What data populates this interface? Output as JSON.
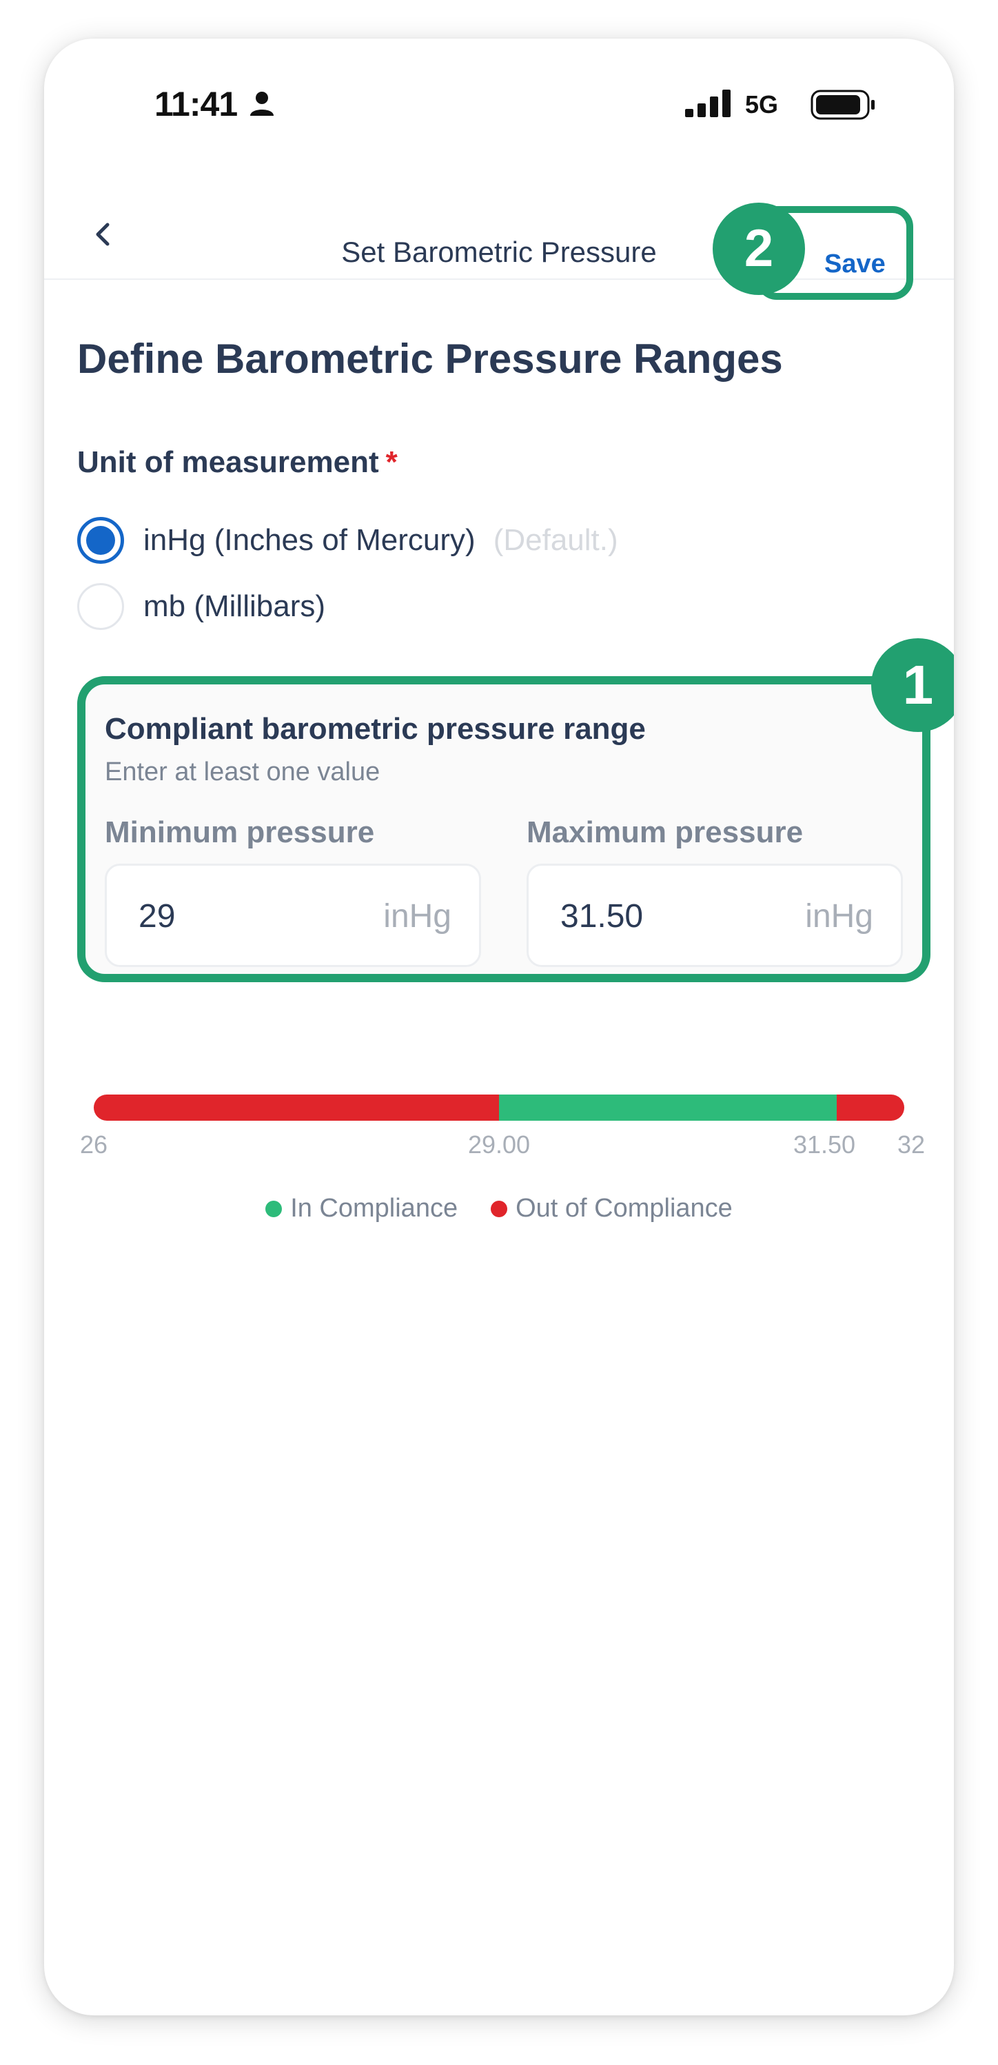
{
  "status_bar": {
    "time": "11:41",
    "network": "5G",
    "icons": [
      "person-icon",
      "signal-icon",
      "battery-icon"
    ]
  },
  "header": {
    "title": "Set Barometric Pressure",
    "save_label": "Save",
    "back_icon": "chevron-left-icon"
  },
  "annotations": {
    "badge_1": "1",
    "badge_2": "2"
  },
  "page": {
    "title": "Define Barometric Pressure Ranges",
    "unit_label": "Unit of measurement",
    "unit_required": "*",
    "options": [
      {
        "label": "inHg (Inches of Mercury)",
        "hint": "(Default.)",
        "selected": true
      },
      {
        "label": "mb (Millibars)",
        "hint": "",
        "selected": false
      }
    ]
  },
  "range_card": {
    "title": "Compliant barometric pressure range",
    "subtitle": "Enter at least one value",
    "min": {
      "label": "Minimum pressure",
      "value": "29",
      "unit": "inHg"
    },
    "max": {
      "label": "Maximum pressure",
      "value": "31.50",
      "unit": "inHg"
    }
  },
  "compliance_bar": {
    "scale_min": 26,
    "scale_max": 32,
    "compliant_from": 29.0,
    "compliant_to": 31.5,
    "ticks": [
      "26",
      "29.00",
      "31.50",
      "32"
    ],
    "colors": {
      "in": "#2dbb7a",
      "out": "#e0252b",
      "accent": "#22a070",
      "link": "#1466c8"
    },
    "legend": {
      "in": "In Compliance",
      "out": "Out of Compliance"
    }
  }
}
